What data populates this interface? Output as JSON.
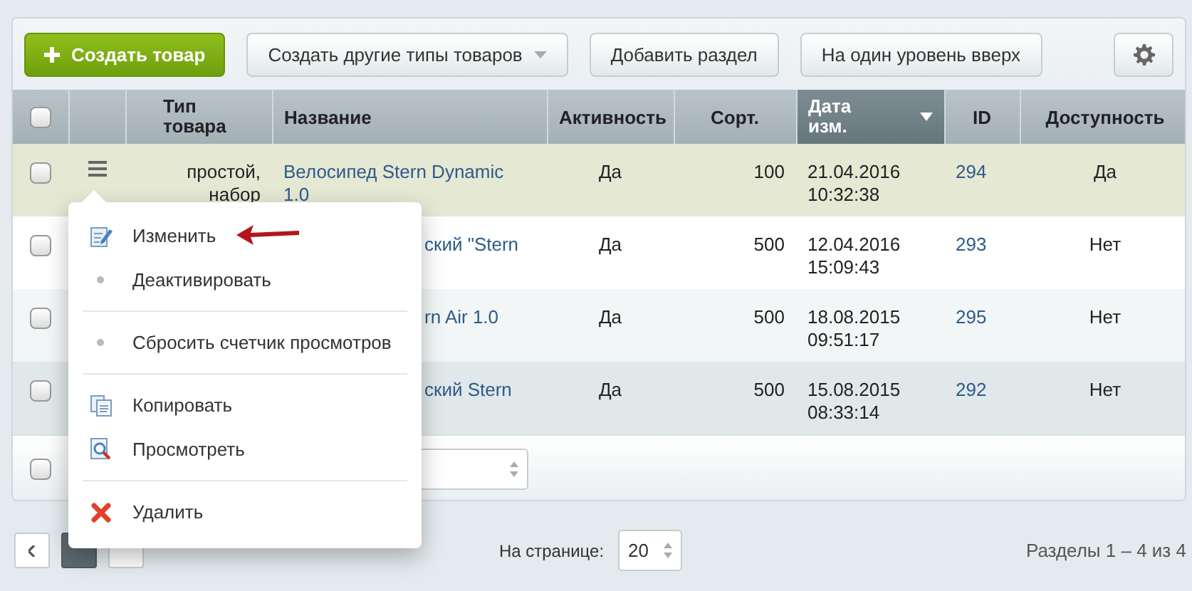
{
  "toolbar": {
    "buttons": [
      {
        "kind": "primary",
        "label": "Создать товар"
      },
      {
        "kind": "dropdown",
        "label": "Создать другие типы товаров"
      },
      {
        "kind": "plain",
        "label": "Добавить раздел"
      },
      {
        "kind": "plain",
        "label": "На один уровень вверх"
      },
      {
        "kind": "settings"
      }
    ]
  },
  "table": {
    "select_all": {
      "checked": false
    },
    "columns": [
      {
        "kind": "type",
        "label": "Тип товара",
        "sorted": false
      },
      {
        "kind": "name",
        "label": "Название",
        "sorted": false
      },
      {
        "kind": "activity",
        "label": "Активность",
        "sorted": false
      },
      {
        "kind": "sort",
        "label": "Сорт.",
        "sorted": false
      },
      {
        "kind": "date",
        "label": "Дата изм.",
        "sorted": true
      },
      {
        "kind": "id",
        "label": "ID",
        "sorted": false
      },
      {
        "kind": "availability",
        "label": "Доступность",
        "sorted": false
      }
    ],
    "rows": [
      {
        "checked": false,
        "selected": true,
        "hovered": false,
        "type": "простой, набор",
        "name": "Велосипед Stern Dynamic 1.0",
        "active": "Да",
        "sort": "100",
        "date": "21.04.2016 10:32:38",
        "id": "294",
        "available": "Да"
      },
      {
        "checked": false,
        "selected": false,
        "hovered": false,
        "name": "ский \"Stern",
        "active": "Да",
        "sort": "500",
        "date": "12.04.2016 15:09:43",
        "id": "293",
        "available": "Нет"
      },
      {
        "checked": false,
        "selected": false,
        "hovered": false,
        "name": "rn Air 1.0",
        "active": "Да",
        "sort": "500",
        "date": "18.08.2015 09:51:17",
        "id": "295",
        "available": "Нет"
      },
      {
        "checked": false,
        "selected": false,
        "hovered": true,
        "name": "ский Stern",
        "active": "Да",
        "sort": "500",
        "date": "15.08.2015 08:33:14",
        "id": "292",
        "available": "Нет"
      }
    ],
    "footer": {
      "checked": false
    }
  },
  "context_menu": {
    "items": [
      {
        "kind": "edit",
        "label": "Изменить",
        "pointed": true
      },
      {
        "kind": "bullet",
        "label": "Деактивировать",
        "pointed": false
      },
      {
        "kind": "separator"
      },
      {
        "kind": "bullet",
        "label": "Сбросить счетчик просмотров",
        "pointed": false
      },
      {
        "kind": "separator"
      },
      {
        "kind": "copy",
        "label": "Копировать",
        "pointed": false
      },
      {
        "kind": "view",
        "label": "Просмотреть",
        "pointed": false
      },
      {
        "kind": "separator"
      },
      {
        "kind": "delete",
        "label": "Удалить",
        "pointed": false
      }
    ]
  },
  "pagination": {
    "pages": [
      {
        "selected": true
      },
      {
        "selected": false
      }
    ],
    "per_page_label": "На странице:",
    "per_page": "20",
    "summary": "Разделы 1 – 4 из 4"
  }
}
